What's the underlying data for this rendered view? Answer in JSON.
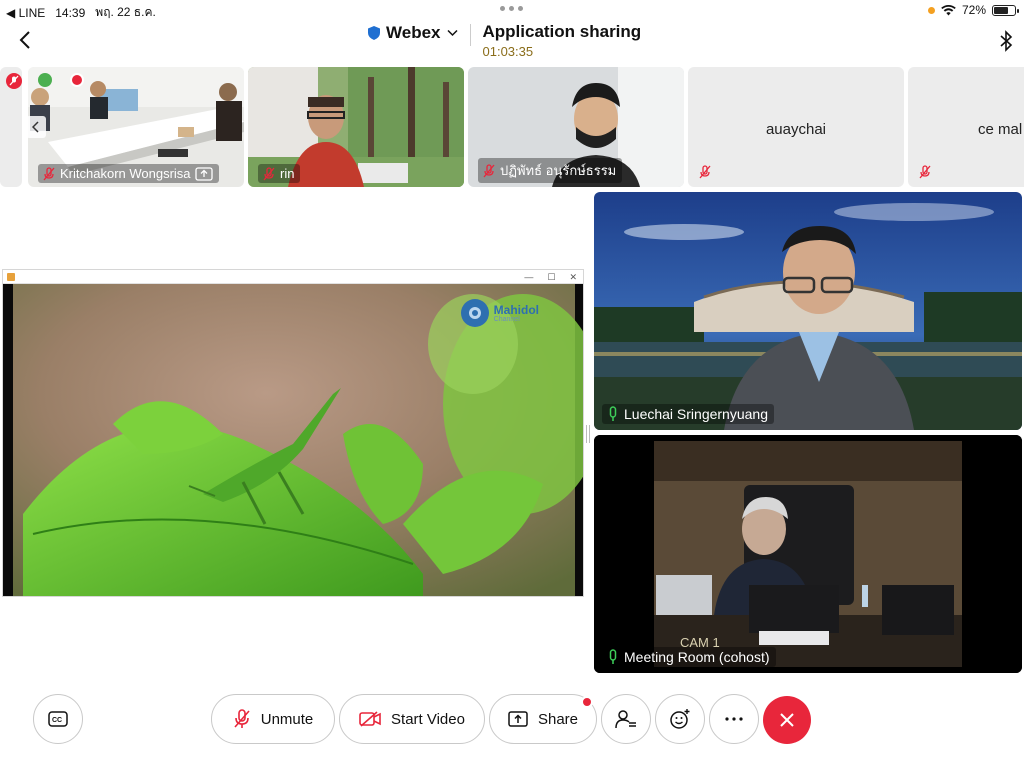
{
  "status_bar": {
    "app_back": "◀ LINE",
    "time": "14:39",
    "date": "พฤ. 22 ธ.ค.",
    "battery": "72%",
    "battery_level": 0.72
  },
  "header": {
    "app_name": "Webex",
    "share_title": "Application sharing",
    "timer": "01:03:35"
  },
  "participants": [
    {
      "name": "Kritchakorn Wongsrisa",
      "muted": true
    },
    {
      "name": "rin",
      "muted": true
    },
    {
      "name": "ปฏิพัทธ์ อนุรักษ์ธรรม",
      "muted": true
    },
    {
      "name": "auaychai",
      "muted": true
    },
    {
      "name": "ce mal",
      "muted": true
    }
  ],
  "shared_content": {
    "brand": "Mahidol",
    "brand_sub": "Channel"
  },
  "video_tiles": [
    {
      "name": "Luechai Sringernyuang"
    },
    {
      "name": "Meeting Room (cohost)"
    }
  ],
  "toolbar": {
    "unmute": "Unmute",
    "start_video": "Start Video",
    "share": "Share"
  },
  "colors": {
    "end_call": "#e8263b",
    "mic_active": "#3ecf5a",
    "timer": "#8a6d1a",
    "mute_red": "#e8263b"
  }
}
